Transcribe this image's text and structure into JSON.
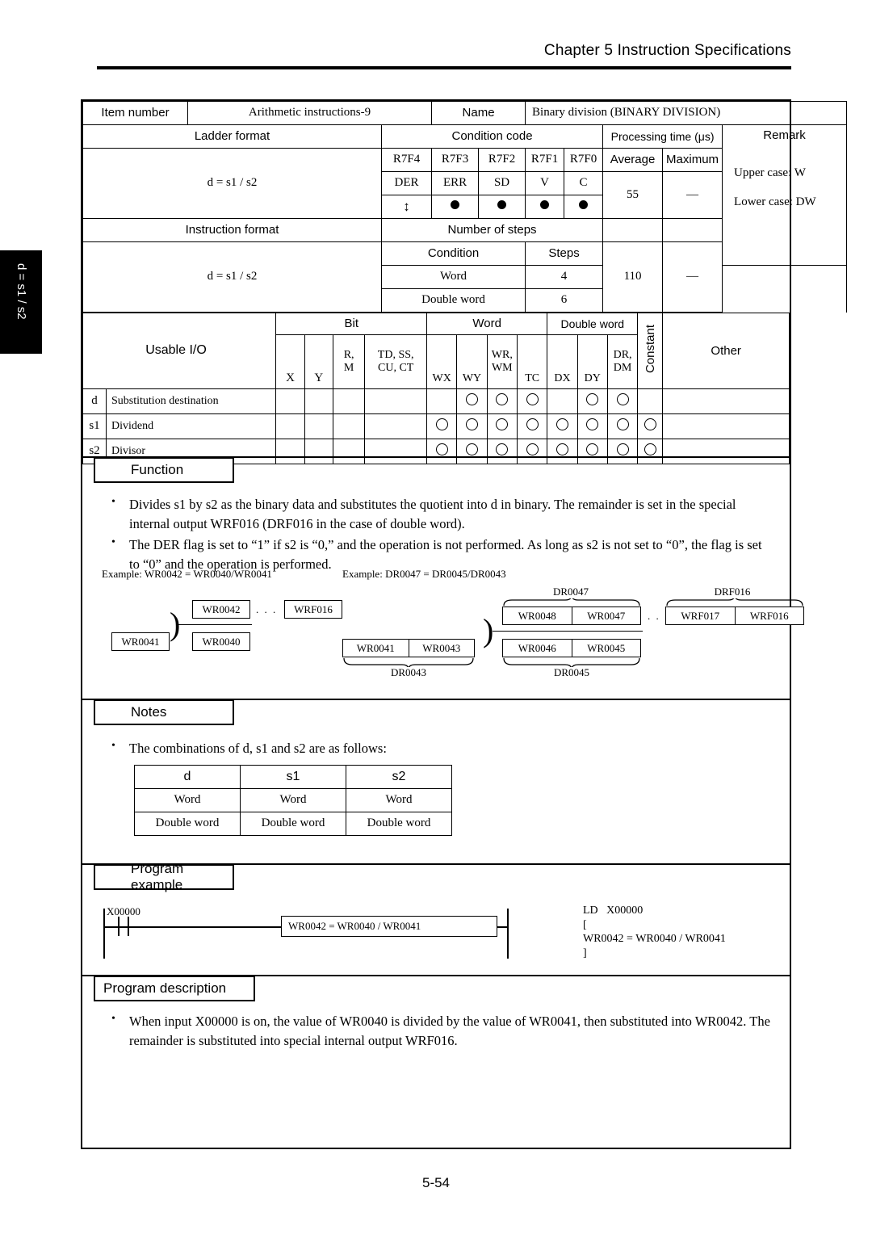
{
  "header": {
    "chapter": "Chapter 5  Instruction Specifications"
  },
  "side_tab": {
    "label": "d = s1 / s2"
  },
  "page_number": "5-54",
  "spec": {
    "item_number_label": "Item number",
    "item_number_value": "Arithmetic instructions-9",
    "name_label": "Name",
    "name_value": "Binary division (BINARY DIVISION)",
    "ladder_format_label": "Ladder format",
    "condition_code_label": "Condition code",
    "processing_time_label": "Processing time (μs)",
    "remark_label": "Remark",
    "ladder_format_value": "d = s1 / s2",
    "cc_registers": [
      "R7F4",
      "R7F3",
      "R7F2",
      "R7F1",
      "R7F0"
    ],
    "cc_flags": [
      "DER",
      "ERR",
      "SD",
      "V",
      "C"
    ],
    "cc_marks": [
      "arrow",
      "dot",
      "dot",
      "dot",
      "dot"
    ],
    "average_label": "Average",
    "maximum_label": "Maximum",
    "average_word": "55",
    "maximum_word": "—",
    "remark_line1": "Upper case: W",
    "remark_line2": "Lower case: DW",
    "instruction_format_label": "Instruction format",
    "number_of_steps_label": "Number of steps",
    "instruction_format_value": "d = s1 / s2",
    "condition_label": "Condition",
    "steps_label": "Steps",
    "steps_rows": [
      {
        "condition": "Word",
        "steps": "4"
      },
      {
        "condition": "Double word",
        "steps": "6"
      }
    ],
    "average_dword": "110",
    "maximum_dword": "—"
  },
  "usable_io": {
    "title": "Usable I/O",
    "groups": [
      "Bit",
      "Word",
      "Double word"
    ],
    "constant_label": "Constant",
    "other_label": "Other",
    "bit_cols": [
      [
        "X"
      ],
      [
        "Y"
      ],
      [
        "R,",
        "M"
      ],
      [
        "TD, SS,",
        "CU, CT"
      ]
    ],
    "word_cols": [
      [
        "WX"
      ],
      [
        "WY"
      ],
      [
        "WR,",
        "WM"
      ],
      [
        "TC"
      ]
    ],
    "dword_cols": [
      [
        "DX"
      ],
      [
        "DY"
      ],
      [
        "DR,",
        "DM"
      ]
    ],
    "rows": [
      {
        "code": "d",
        "desc": "Substitution destination",
        "marks": [
          0,
          0,
          0,
          0,
          0,
          1,
          1,
          1,
          0,
          1,
          1,
          0
        ]
      },
      {
        "code": "s1",
        "desc": "Dividend",
        "marks": [
          0,
          0,
          0,
          0,
          1,
          1,
          1,
          1,
          1,
          1,
          1,
          1
        ]
      },
      {
        "code": "s2",
        "desc": "Divisor",
        "marks": [
          0,
          0,
          0,
          0,
          1,
          1,
          1,
          1,
          1,
          1,
          1,
          1
        ]
      }
    ]
  },
  "function": {
    "tab_label": "Function",
    "bullets": [
      "Divides s1 by s2 as the binary data and substitutes the quotient into d in binary.  The remainder is set in the special internal output WRF016 (DRF016 in the case of double word).",
      "The DER flag is set to “1” if s2 is “0,” and the operation is not performed.  As long as s2 is not set to “0”, the flag is set to “0” and the operation is performed."
    ],
    "example_left_caption": "Example: WR0042 = WR0040/WR0041",
    "example_right_caption": "Example: DR0047 = DR0045/DR0043",
    "left_diagram": {
      "quotient": "WR0042",
      "dividend": "WR0040",
      "divisor": "WR0041",
      "remainder": "WRF016",
      "dots": ". . ."
    },
    "right_diagram": {
      "quotient_label": "DR0047",
      "quotient_hi": "WR0048",
      "quotient_lo": "WR0047",
      "remainder_label": "DRF016",
      "remainder_hi": "WRF017",
      "remainder_lo": "WRF016",
      "divisor_label": "DR0043",
      "divisor_hi": "WR0041",
      "divisor_lo": "WR0043",
      "dividend_label": "DR0045",
      "dividend_hi": "WR0046",
      "dividend_lo": "WR0045",
      "dots": ". . ."
    }
  },
  "notes": {
    "tab_label": "Notes",
    "bullet": "The combinations of d, s1 and s2 are as follows:",
    "table": {
      "headers": [
        "d",
        "s1",
        "s2"
      ],
      "rows": [
        [
          "Word",
          "Word",
          "Word"
        ],
        [
          "Double word",
          "Double word",
          "Double word"
        ]
      ]
    }
  },
  "program_example": {
    "tab_label": "Program example",
    "contact_label": "X00000",
    "box_label": "WR0042 = WR0040 / WR0041",
    "mnemonic_lines": [
      "LD   X00000",
      "[",
      "WR0042 = WR0040 / WR0041",
      "]"
    ]
  },
  "program_description": {
    "tab_label": "Program description",
    "bullets": [
      "When input X00000 is on, the value of WR0040 is divided by the value of WR0041, then substituted into WR0042.  The remainder is substituted into special internal output WRF016."
    ]
  }
}
